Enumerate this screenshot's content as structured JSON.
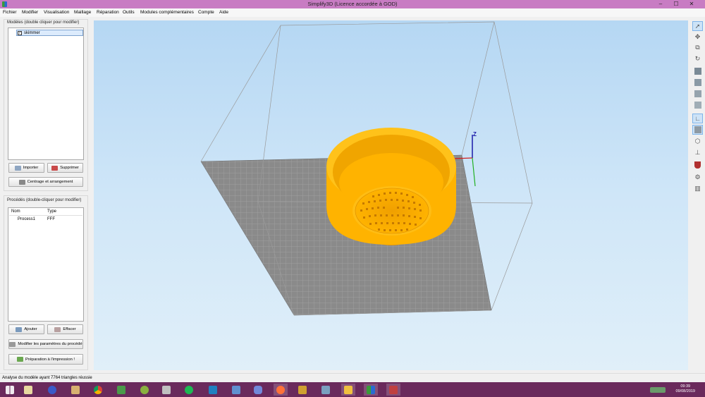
{
  "window": {
    "title": "Simplify3D (Licence accordée à GOD)",
    "minimize": "–",
    "maximize": "☐",
    "close": "✕"
  },
  "menu": [
    "Fichier",
    "Modifier",
    "Visualisation",
    "Maillage",
    "Réparation",
    "Outils",
    "Modules complémentaires",
    "Compte",
    "Aide"
  ],
  "models": {
    "title": "Modèles (double cliquer pour modifier)",
    "items": [
      {
        "name": "skimmer",
        "checked": true
      }
    ],
    "import_label": "Importer",
    "delete_label": "Supprimer",
    "center_label": "Centrage et arrangement"
  },
  "processes": {
    "title": "Procédés (double-cliquer pour modifier)",
    "columns": [
      "Nom",
      "Type"
    ],
    "rows": [
      {
        "name": "Process1",
        "type": "FFF"
      }
    ],
    "add_label": "Ajouter",
    "remove_label": "Effacer",
    "edit_label": "Modifier les paramètres du procédé",
    "prepare_label": "Préparation à l'impression !"
  },
  "viewport": {
    "axis_label": "Z",
    "model_color": "#ffb300",
    "bed_color": "#8a8a8a"
  },
  "right_tools": [
    "select-icon",
    "move-icon",
    "scale-icon",
    "rotate-icon",
    "view-default-icon",
    "view-front-icon",
    "view-top-icon",
    "view-side-icon",
    "axes-icon",
    "cube-icon",
    "bounding-box-icon",
    "axis-small-icon",
    "shield-icon",
    "gear-icon",
    "layers-icon"
  ],
  "status": {
    "text": "Analyse du modèle ayant 7764 triangles réussie"
  },
  "taskbar": {
    "time": "09:39",
    "date": "09/08/2019"
  }
}
